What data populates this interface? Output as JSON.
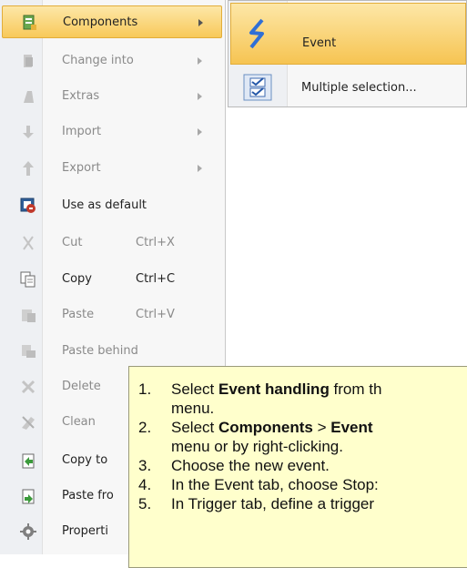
{
  "menu": {
    "items": [
      {
        "label": "Components",
        "shortcut": "",
        "icon": "components-icon",
        "submenu": true,
        "disabled": false,
        "highlighted": true
      },
      {
        "label": "Change into",
        "shortcut": "",
        "icon": "change-into-icon",
        "submenu": true,
        "disabled": true
      },
      {
        "label": "Extras",
        "shortcut": "",
        "icon": "extras-icon",
        "submenu": true,
        "disabled": true
      },
      {
        "label": "Import",
        "shortcut": "",
        "icon": "import-icon",
        "submenu": true,
        "disabled": true
      },
      {
        "label": "Export",
        "shortcut": "",
        "icon": "export-icon",
        "submenu": true,
        "disabled": true
      },
      {
        "label": "Use as default",
        "shortcut": "",
        "icon": "use-as-default-icon",
        "submenu": false,
        "disabled": false
      },
      {
        "label": "Cut",
        "shortcut": "Ctrl+X",
        "icon": "cut-icon",
        "submenu": false,
        "disabled": true
      },
      {
        "label": "Copy",
        "shortcut": "Ctrl+C",
        "icon": "copy-icon",
        "submenu": false,
        "disabled": false
      },
      {
        "label": "Paste",
        "shortcut": "Ctrl+V",
        "icon": "paste-icon",
        "submenu": false,
        "disabled": true
      },
      {
        "label": "Paste behind",
        "shortcut": "",
        "icon": "paste-behind-icon",
        "submenu": false,
        "disabled": true
      },
      {
        "label": "Delete",
        "shortcut": "",
        "icon": "delete-icon",
        "submenu": false,
        "disabled": true
      },
      {
        "label": "Clean",
        "shortcut": "",
        "icon": "clean-icon",
        "submenu": false,
        "disabled": true
      },
      {
        "label": "Copy to",
        "shortcut": "",
        "icon": "copy-to-icon",
        "submenu": false,
        "disabled": false
      },
      {
        "label": "Paste fro",
        "shortcut": "",
        "icon": "paste-from-icon",
        "submenu": false,
        "disabled": false
      },
      {
        "label": "Properti",
        "shortcut": "",
        "icon": "properties-icon",
        "submenu": false,
        "disabled": false
      }
    ]
  },
  "submenu": {
    "items": [
      {
        "label": "Event",
        "icon": "event-icon",
        "highlighted": true
      },
      {
        "label": "Multiple selection...",
        "icon": "multiple-selection-icon",
        "highlighted": false
      }
    ]
  },
  "callout": {
    "steps": [
      {
        "num": "1.",
        "parts": [
          {
            "t": "Select ",
            "b": false
          },
          {
            "t": "Event handling",
            "b": true
          },
          {
            "t": " from th",
            "b": false
          }
        ]
      },
      {
        "num": "",
        "parts": [
          {
            "t": "menu.",
            "b": false
          }
        ]
      },
      {
        "num": "2.",
        "parts": [
          {
            "t": "Select ",
            "b": false
          },
          {
            "t": "Components",
            "b": true
          },
          {
            "t": " > ",
            "b": false
          },
          {
            "t": "Event",
            "b": true
          }
        ]
      },
      {
        "num": "",
        "parts": [
          {
            "t": "menu or by right-clicking.",
            "b": false
          }
        ]
      },
      {
        "num": "3.",
        "parts": [
          {
            "t": "Choose the new event.",
            "b": false
          }
        ]
      },
      {
        "num": "4.",
        "parts": [
          {
            "t": "In the Event tab, choose Stop:",
            "b": false
          }
        ]
      },
      {
        "num": "5.",
        "parts": [
          {
            "t": "In Trigger tab, define a trigger",
            "b": false
          }
        ]
      }
    ]
  },
  "colors": {
    "highlight": "#f8c95a",
    "callout_bg": "#ffffcc"
  }
}
